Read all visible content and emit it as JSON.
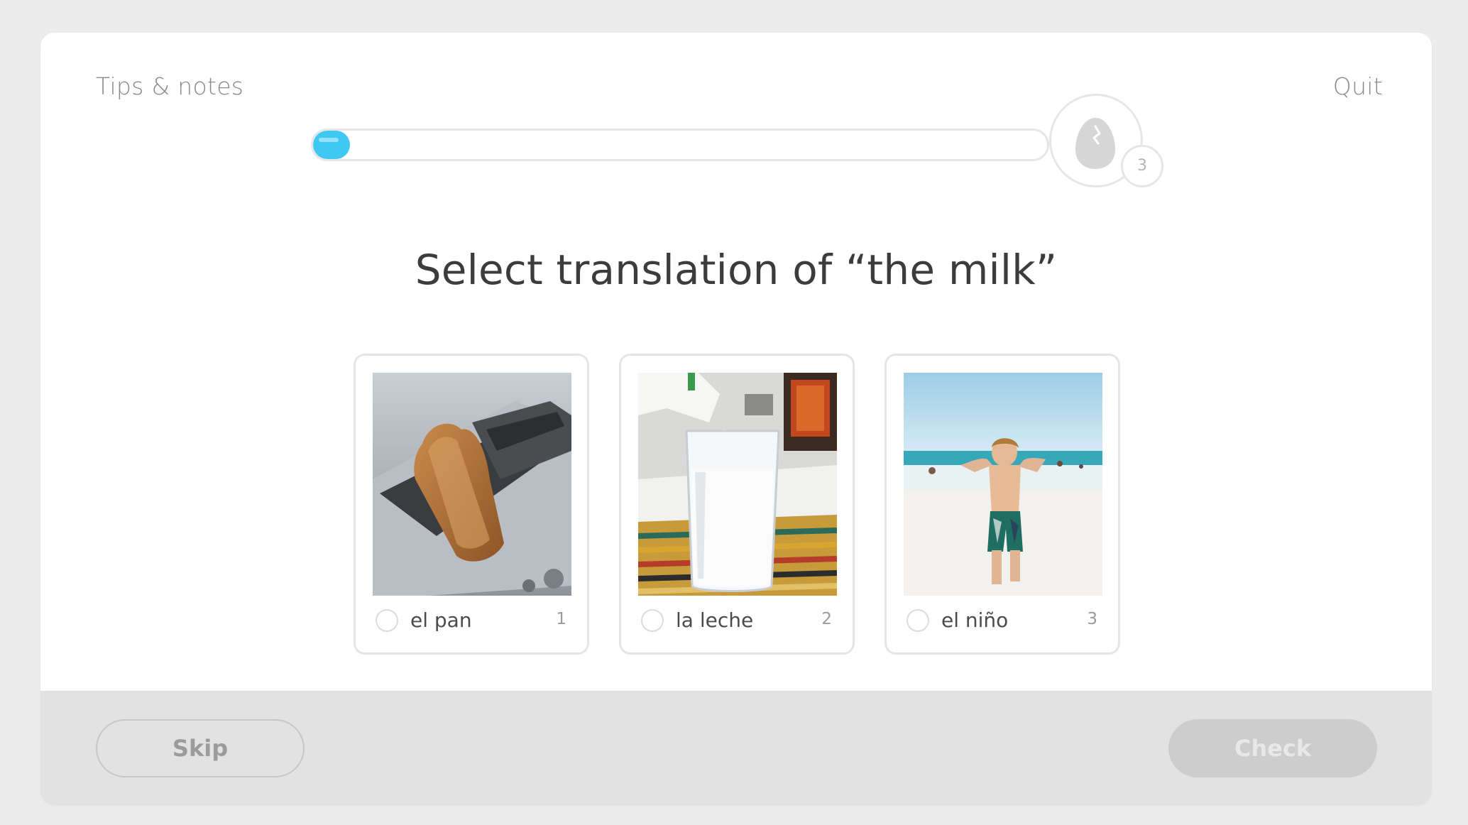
{
  "header": {
    "tips_label": "Tips & notes",
    "quit_label": "Quit"
  },
  "progress": {
    "fraction": 0.05,
    "fill_color": "#3ec8f2",
    "lessons_left": "3"
  },
  "prompt": {
    "title": "Select translation of “the milk”"
  },
  "choices": [
    {
      "label": "el pan",
      "key": "1",
      "image": "toast-in-toaster-photo"
    },
    {
      "label": "la leche",
      "key": "2",
      "image": "glass-of-milk-photo"
    },
    {
      "label": "el niño",
      "key": "3",
      "image": "boy-on-beach-photo"
    }
  ],
  "footer": {
    "skip_label": "Skip",
    "check_label": "Check"
  },
  "colors": {
    "accent": "#3ec8f2",
    "background": "#ececec",
    "footer": "#e2e2e2"
  }
}
